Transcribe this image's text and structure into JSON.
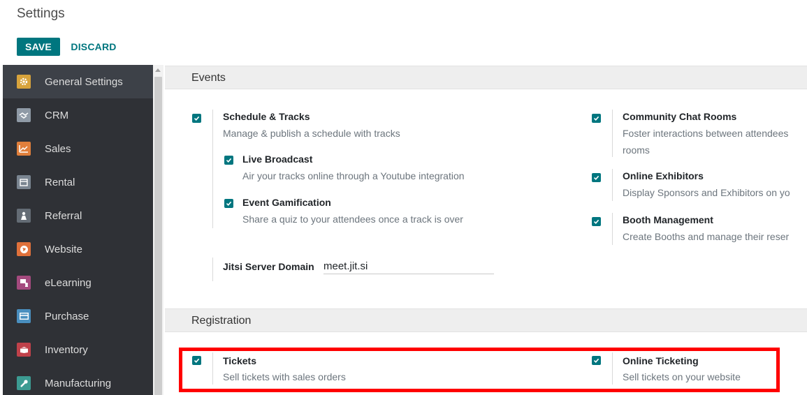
{
  "header": {
    "title": "Settings"
  },
  "toolbar": {
    "save_label": "SAVE",
    "discard_label": "DISCARD"
  },
  "sidebar": {
    "items": [
      {
        "label": "General Settings",
        "icon": "gear-icon",
        "color": "#d7a33c"
      },
      {
        "label": "CRM",
        "icon": "handshake-icon",
        "color": "#8f9aa6"
      },
      {
        "label": "Sales",
        "icon": "chart-icon",
        "color": "#e07f3c"
      },
      {
        "label": "Rental",
        "icon": "calendar-icon",
        "color": "#7a8591"
      },
      {
        "label": "Referral",
        "icon": "person-icon",
        "color": "#646c75"
      },
      {
        "label": "Website",
        "icon": "globe-icon",
        "color": "#e0713b"
      },
      {
        "label": "eLearning",
        "icon": "elearning-icon",
        "color": "#a44a7e"
      },
      {
        "label": "Purchase",
        "icon": "card-icon",
        "color": "#4a8fbf"
      },
      {
        "label": "Inventory",
        "icon": "box-icon",
        "color": "#c0414a"
      },
      {
        "label": "Manufacturing",
        "icon": "wrench-icon",
        "color": "#3c9b92"
      }
    ]
  },
  "events": {
    "section_title": "Events",
    "schedule_tracks": {
      "title": "Schedule & Tracks",
      "desc": "Manage & publish a schedule with tracks"
    },
    "live_broadcast": {
      "title": "Live Broadcast",
      "desc": "Air your tracks online through a Youtube integration"
    },
    "gamification": {
      "title": "Event Gamification",
      "desc": "Share a quiz to your attendees once a track is over"
    },
    "jitsi": {
      "label": "Jitsi Server Domain",
      "value": "meet.jit.si"
    },
    "chat_rooms": {
      "title": "Community Chat Rooms",
      "desc_line1": "Foster interactions between attendees",
      "desc_line2": "rooms"
    },
    "exhibitors": {
      "title": "Online Exhibitors",
      "desc": "Display Sponsors and Exhibitors on yo"
    },
    "booth": {
      "title": "Booth Management",
      "desc": "Create Booths and manage their reser"
    }
  },
  "registration": {
    "section_title": "Registration",
    "tickets": {
      "title": "Tickets",
      "desc": "Sell tickets with sales orders"
    },
    "online_ticketing": {
      "title": "Online Ticketing",
      "desc": "Sell tickets on your website"
    }
  },
  "colors": {
    "accent": "#00767f",
    "sidebar_bg": "#2f3136",
    "highlight": "#ff0000"
  }
}
